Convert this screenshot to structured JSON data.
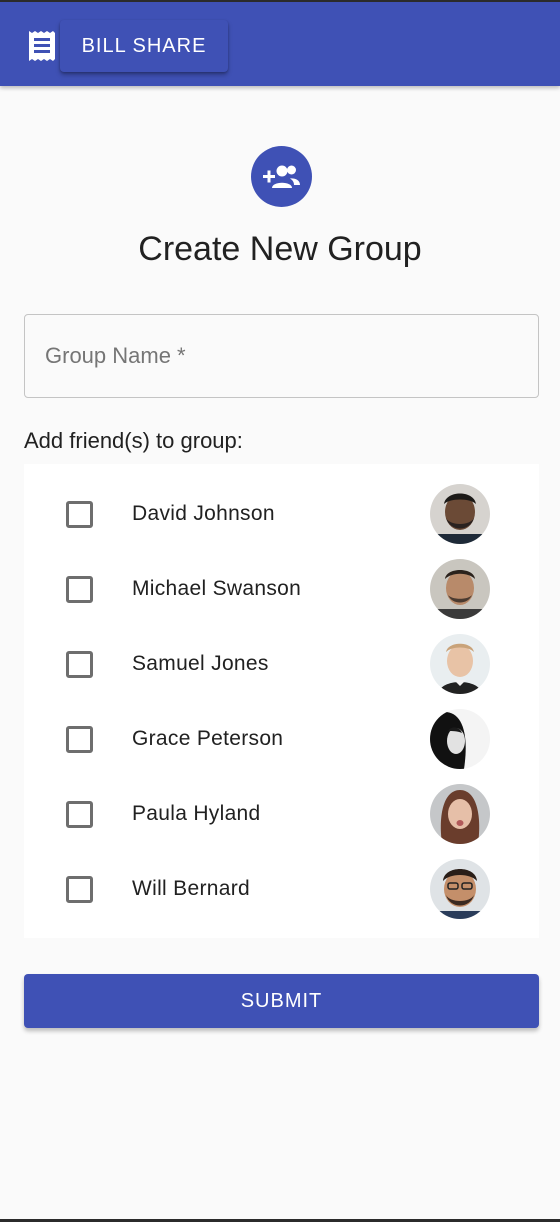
{
  "app_bar": {
    "brand_label": "BILL SHARE",
    "menu_icon": "receipt-icon",
    "color": "#3f51b5"
  },
  "header": {
    "icon": "group-add-icon",
    "title": "Create New Group"
  },
  "form": {
    "group_name_value": "",
    "group_name_placeholder": "Group Name *"
  },
  "friends": {
    "label": "Add friend(s) to group:",
    "items": [
      {
        "name": "David Johnson",
        "checked": false
      },
      {
        "name": "Michael Swanson",
        "checked": false
      },
      {
        "name": "Samuel Jones",
        "checked": false
      },
      {
        "name": "Grace Peterson",
        "checked": false
      },
      {
        "name": "Paula Hyland",
        "checked": false
      },
      {
        "name": "Will Bernard",
        "checked": false
      }
    ]
  },
  "actions": {
    "submit_label": "SUBMIT"
  }
}
